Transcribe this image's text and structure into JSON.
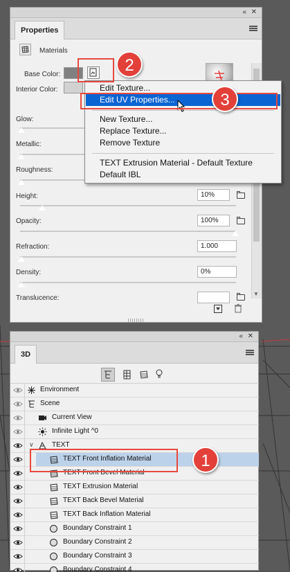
{
  "colors": {
    "panel_bg": "#f0f0f0",
    "highlight": "#0a64d2",
    "row_selected": "#bcd2ea",
    "callout": "#e3403a"
  },
  "properties_panel": {
    "tab_label": "Properties",
    "section_label": "Materials",
    "base_color_label": "Base Color:",
    "interior_color_label": "Interior Color:",
    "controls": [
      {
        "label": "Glow:",
        "value": ""
      },
      {
        "label": "Metallic:",
        "value": ""
      },
      {
        "label": "Roughness:",
        "value": ""
      },
      {
        "label": "Height:",
        "value": "10%"
      },
      {
        "label": "Opacity:",
        "value": "100%"
      },
      {
        "label": "Refraction:",
        "value": "1.000"
      },
      {
        "label": "Density:",
        "value": "0%"
      },
      {
        "label": "Translucence:",
        "value": ""
      }
    ]
  },
  "context_menu": {
    "items": [
      "Edit Texture...",
      "Edit UV Properties...",
      "New Texture...",
      "Replace Texture...",
      "Remove Texture",
      "TEXT Extrusion Material - Default Texture",
      "Default IBL"
    ],
    "highlighted_index": 1
  },
  "panel_3d": {
    "tab_label": "3D",
    "scene_rows": [
      {
        "label": "Environment",
        "icon": "environment-icon",
        "indent": 0
      },
      {
        "label": "Scene",
        "icon": "scene-icon",
        "indent": 0
      },
      {
        "label": "Current View",
        "icon": "camera-icon",
        "indent": 1
      },
      {
        "label": "Infinite Light ^0",
        "icon": "light-icon",
        "indent": 1
      },
      {
        "label": "TEXT",
        "icon": "mesh-icon",
        "indent": 1
      },
      {
        "label": "TEXT Front Inflation Material",
        "icon": "material-icon",
        "indent": 2
      },
      {
        "label": "TEXT Front Bevel Material",
        "icon": "material-icon",
        "indent": 2
      },
      {
        "label": "TEXT Extrusion Material",
        "icon": "material-icon",
        "indent": 2
      },
      {
        "label": "TEXT Back Bevel Material",
        "icon": "material-icon",
        "indent": 2
      },
      {
        "label": "TEXT Back Inflation Material",
        "icon": "material-icon",
        "indent": 2
      },
      {
        "label": "Boundary Constraint 1",
        "icon": "constraint-icon",
        "indent": 2
      },
      {
        "label": "Boundary Constraint 2",
        "icon": "constraint-icon",
        "indent": 2
      },
      {
        "label": "Boundary Constraint 3",
        "icon": "constraint-icon",
        "indent": 2
      },
      {
        "label": "Boundary Constraint 4",
        "icon": "constraint-icon",
        "indent": 2
      }
    ],
    "selected_index": 5
  },
  "callouts": [
    "2",
    "3",
    "1"
  ]
}
